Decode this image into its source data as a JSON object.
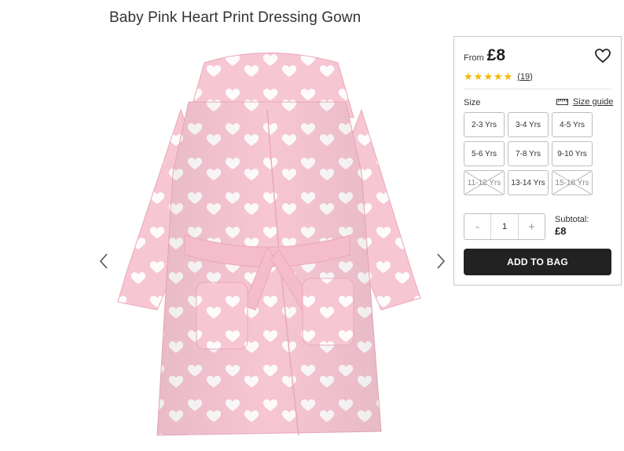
{
  "product": {
    "title": "Baby Pink Heart Print Dressing Gown"
  },
  "gallery": {
    "prev_icon": "chevron-left-icon",
    "next_icon": "chevron-right-icon",
    "image_subject": "pink hooded dressing gown with white heart print"
  },
  "purchase": {
    "price_prefix": "From",
    "price": "£8",
    "wishlist_icon": "heart-outline-icon",
    "rating": 5,
    "review_count": "(19)",
    "size_label": "Size",
    "size_guide_label": "Size guide",
    "size_guide_icon": "ruler-icon",
    "sizes": [
      {
        "label": "2-3 Yrs",
        "available": true
      },
      {
        "label": "3-4 Yrs",
        "available": true
      },
      {
        "label": "4-5 Yrs",
        "available": true
      },
      {
        "label": "5-6 Yrs",
        "available": true
      },
      {
        "label": "7-8 Yrs",
        "available": true
      },
      {
        "label": "9-10 Yrs",
        "available": true
      },
      {
        "label": "11-12 Yrs",
        "available": false
      },
      {
        "label": "13-14 Yrs",
        "available": true
      },
      {
        "label": "15-16 Yrs",
        "available": false
      }
    ],
    "qty_minus": "-",
    "qty_value": "1",
    "qty_plus": "+",
    "subtotal_label": "Subtotal:",
    "subtotal_value": "£8",
    "add_to_bag": "ADD TO BAG"
  },
  "colors": {
    "star": "#f5b800",
    "button_bg": "#222222",
    "gown_pink": "#f7c6d3",
    "heart_white": "#ffffff"
  }
}
